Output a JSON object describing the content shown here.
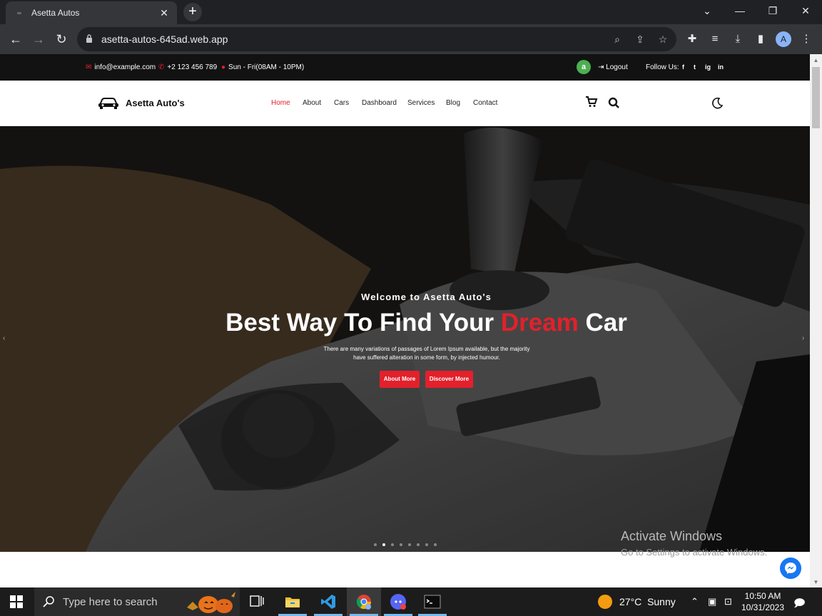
{
  "browser": {
    "tab_title": "Asetta Autos",
    "tab_close": "✕",
    "new_tab": "+",
    "url": "asetta-autos-645ad.web.app",
    "profile_initial": "A"
  },
  "topbar": {
    "email": "info@example.com",
    "phone": "+2 123 456 789",
    "hours": "Sun - Fri(08AM - 10PM)",
    "user_initial": "a",
    "logout": "Logout",
    "follow_us": "Follow Us:",
    "social": [
      "f",
      "t",
      "ig",
      "in"
    ]
  },
  "header": {
    "brand": "Asetta Auto's",
    "nav": [
      "Home",
      "About",
      "Cars",
      "Dashboard",
      "Services",
      "Blog",
      "Contact"
    ],
    "active_nav": "Home"
  },
  "hero": {
    "welcome": "Welcome to Asetta Auto's",
    "headline_pre": "Best Way To Find Your ",
    "headline_accent": "Dream",
    "headline_post": " Car",
    "subtitle": "There are many variations of passages of Lorem Ipsum available, but the majority have suffered alteration in some form, by injected humour.",
    "button_primary": "About More",
    "button_secondary": "Discover More",
    "slide_count": 8,
    "active_slide": 1,
    "accent_color": "#e3202b"
  },
  "overlay": {
    "activate_title": "Activate Windows",
    "activate_sub": "Go to Settings to activate Windows."
  },
  "taskbar": {
    "search_placeholder": "Type here to search",
    "temperature": "27°C",
    "weather": "Sunny",
    "time": "10:50 AM",
    "date": "10/31/2023"
  }
}
